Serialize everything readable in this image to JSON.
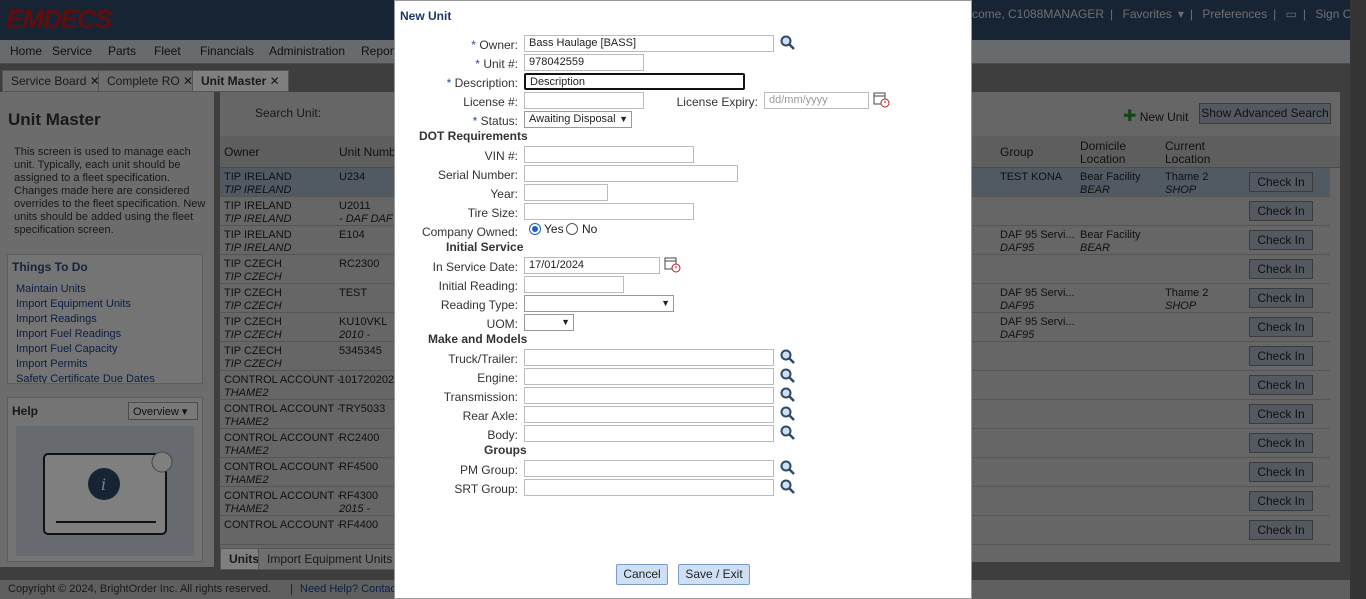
{
  "app": {
    "logo": "EMDECS",
    "welcome": "come, C1088MANAGER",
    "favorites": "Favorites",
    "preferences": "Preferences",
    "signout": "Sign Out"
  },
  "nav": [
    "Home",
    "Service",
    "Parts",
    "Fleet",
    "Financials",
    "Administration",
    "Reports"
  ],
  "tabs": [
    "Service Board",
    "Complete RO",
    "Unit Master"
  ],
  "left": {
    "title": "Unit Master",
    "description": "This screen is used to manage each unit. Typically, each unit should be assigned to a fleet specification. Changes made here are considered overrides to the fleet specification. New units should be added using the fleet specification screen.",
    "todo_title": "Things To Do",
    "todo": [
      "Maintain Units",
      "Import Equipment Units",
      "Import Readings",
      "Import Fuel Readings",
      "Import Fuel Capacity",
      "Import Permits",
      "Safety Certificate Due Dates"
    ],
    "help_title": "Help",
    "help_select": "Overview"
  },
  "grid": {
    "search_label": "Search Unit:",
    "new_unit": "New Unit",
    "advanced": "Show Advanced Search",
    "headers": {
      "owner": "Owner",
      "unit": "Unit Number",
      "group": "Group",
      "domicile": "Domicile Location",
      "current": "Current Location"
    },
    "check_in": "Check In",
    "rows": [
      {
        "owner": "TIP IRELAND",
        "owner2": "TIP IRELAND",
        "unit": "U234",
        "unit2": "",
        "group": "TEST KONA",
        "group2": "",
        "dom": "Bear Facility",
        "dom2": "BEAR",
        "cur": "Thame 2",
        "cur2": "SHOP"
      },
      {
        "owner": "TIP IRELAND",
        "owner2": "TIP IRELAND",
        "unit": "U2011",
        "unit2": "- DAF DAF",
        "group": "",
        "group2": "",
        "dom": "",
        "dom2": "",
        "cur": "",
        "cur2": ""
      },
      {
        "owner": "TIP IRELAND",
        "owner2": "TIP IRELAND",
        "unit": "E104",
        "unit2": "",
        "group": "DAF 95 Servi...",
        "group2": "DAF95",
        "dom": "Bear Facility",
        "dom2": "BEAR",
        "cur": "",
        "cur2": ""
      },
      {
        "owner": "TIP CZECH",
        "owner2": "TIP CZECH",
        "unit": "RC2300",
        "unit2": "",
        "group": "",
        "group2": "",
        "dom": "",
        "dom2": "",
        "cur": "",
        "cur2": ""
      },
      {
        "owner": "TIP CZECH",
        "owner2": "TIP CZECH",
        "unit": "TEST",
        "unit2": "",
        "group": "DAF 95 Servi...",
        "group2": "DAF95",
        "dom": "",
        "dom2": "",
        "cur": "Thame 2",
        "cur2": "SHOP"
      },
      {
        "owner": "TIP CZECH",
        "owner2": "TIP CZECH",
        "unit": "KU10VKL",
        "unit2": "2010 -",
        "group": "DAF 95 Servi...",
        "group2": "DAF95",
        "dom": "",
        "dom2": "",
        "cur": "",
        "cur2": ""
      },
      {
        "owner": "TIP CZECH",
        "owner2": "TIP CZECH",
        "unit": "5345345",
        "unit2": "",
        "group": "",
        "group2": "",
        "dom": "",
        "dom2": "",
        "cur": "",
        "cur2": ""
      },
      {
        "owner": "CONTROL ACCOUNT -",
        "owner2": "THAME2",
        "unit": "101720202",
        "unit2": "",
        "group": "",
        "group2": "",
        "dom": "",
        "dom2": "",
        "cur": "",
        "cur2": ""
      },
      {
        "owner": "CONTROL ACCOUNT -",
        "owner2": "THAME2",
        "unit": "TRY5033",
        "unit2": "",
        "group": "",
        "group2": "",
        "dom": "",
        "dom2": "",
        "cur": "",
        "cur2": ""
      },
      {
        "owner": "CONTROL ACCOUNT -",
        "owner2": "THAME2",
        "unit": "RC2400",
        "unit2": "",
        "group": "",
        "group2": "",
        "dom": "",
        "dom2": "",
        "cur": "",
        "cur2": ""
      },
      {
        "owner": "CONTROL ACCOUNT -",
        "owner2": "THAME2",
        "unit": "RF4500",
        "unit2": "",
        "group": "",
        "group2": "",
        "dom": "",
        "dom2": "",
        "cur": "",
        "cur2": ""
      },
      {
        "owner": "CONTROL ACCOUNT -",
        "owner2": "THAME2",
        "unit": "RF4300",
        "unit2": "2015 -",
        "group": "",
        "group2": "",
        "dom": "",
        "dom2": "",
        "cur": "",
        "cur2": ""
      },
      {
        "owner": "CONTROL ACCOUNT -",
        "owner2": "",
        "unit": "RF4400",
        "unit2": "",
        "group": "",
        "group2": "",
        "dom": "",
        "dom2": "",
        "cur": "",
        "cur2": ""
      }
    ],
    "bottom_tabs": [
      "Units",
      "Import Equipment Units"
    ]
  },
  "footer": {
    "copyright": "Copyright © 2024, BrightOrder Inc. All rights reserved.",
    "help": "Need Help? Contact"
  },
  "modal": {
    "title": "New Unit",
    "owner_label": "Owner:",
    "owner_value": "Bass Haulage [BASS]",
    "unit_label": "Unit #:",
    "unit_value": "978042559",
    "desc_label": "Description:",
    "desc_value": "Description",
    "license_label": "License #:",
    "license_expiry_label": "License Expiry:",
    "license_expiry_placeholder": "dd/mm/yyyy",
    "status_label": "Status:",
    "status_value": "Awaiting Disposal",
    "dot_section": "DOT Requirements",
    "vin_label": "VIN #:",
    "serial_label": "Serial Number:",
    "year_label": "Year:",
    "tire_label": "Tire Size:",
    "company_owned_label": "Company Owned:",
    "yes": "Yes",
    "no": "No",
    "initial_section": "Initial Service",
    "in_service_label": "In Service Date:",
    "in_service_value": "17/01/2024",
    "initial_reading_label": "Initial Reading:",
    "reading_type_label": "Reading Type:",
    "uom_label": "UOM:",
    "make_section": "Make and Models",
    "truck_label": "Truck/Trailer:",
    "engine_label": "Engine:",
    "transmission_label": "Transmission:",
    "rear_axle_label": "Rear Axle:",
    "body_label": "Body:",
    "groups_section": "Groups",
    "pm_label": "PM Group:",
    "srt_label": "SRT Group:",
    "cancel": "Cancel",
    "save": "Save / Exit"
  }
}
